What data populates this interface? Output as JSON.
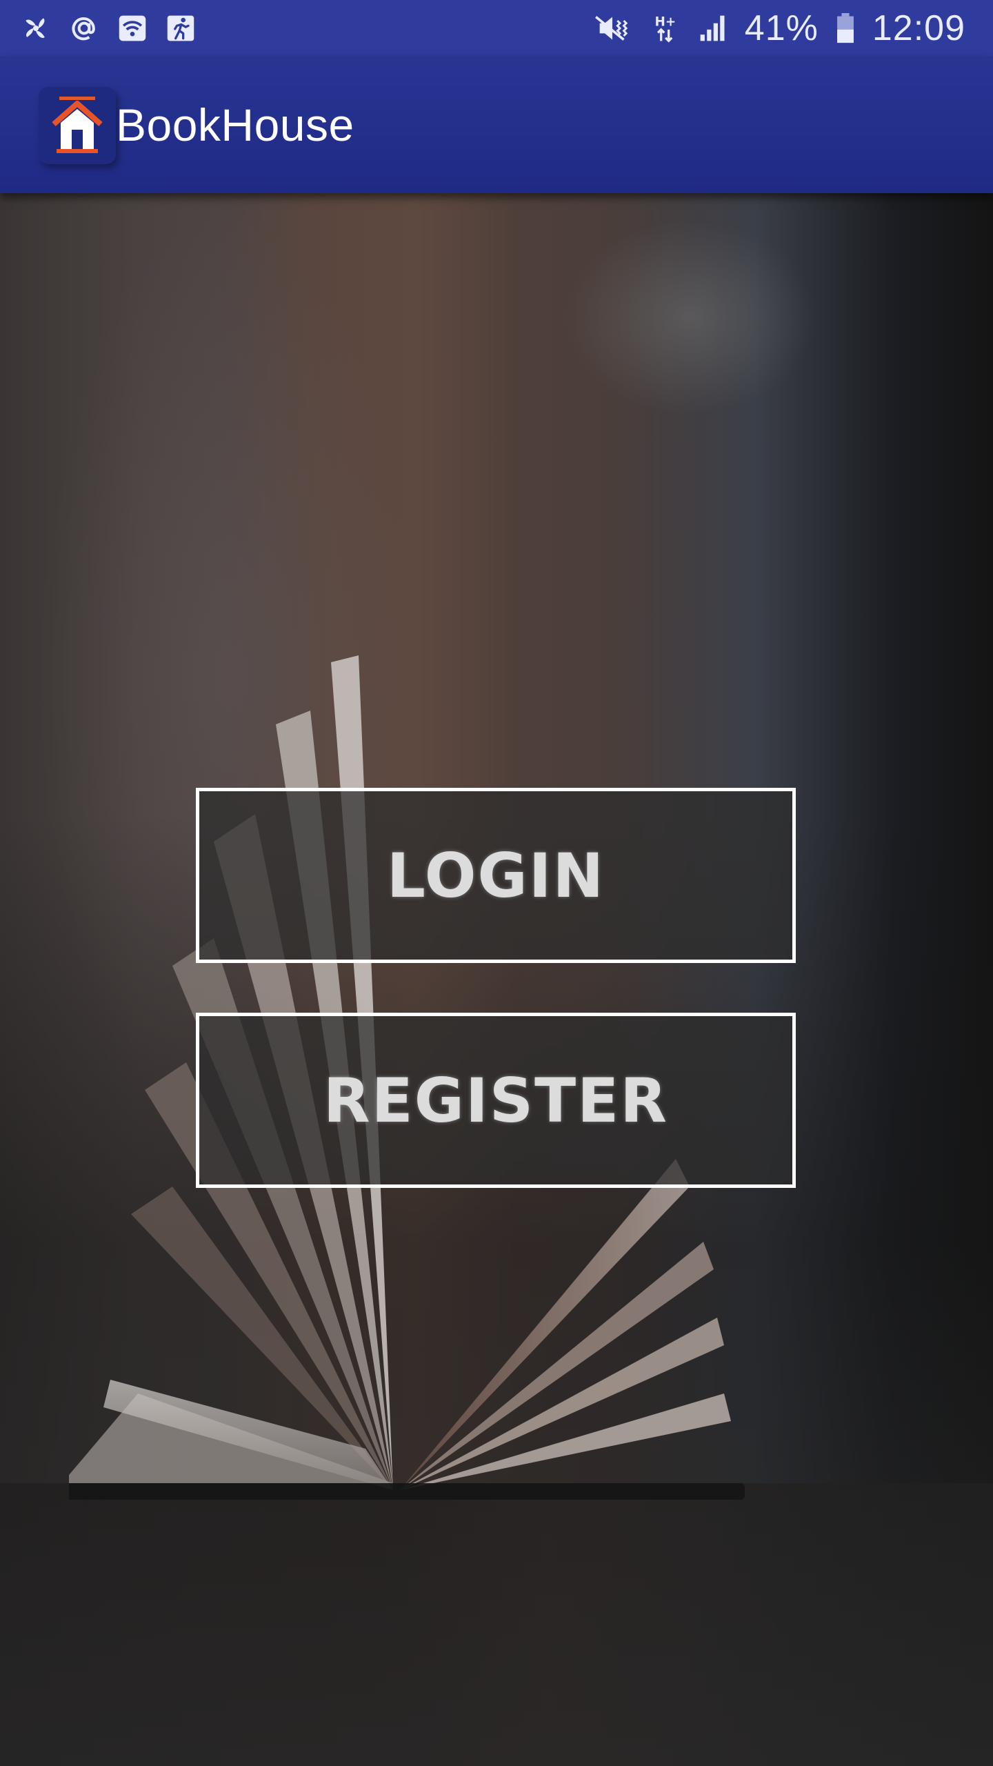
{
  "status_bar": {
    "left_icons": [
      "fan-icon",
      "at-sign-icon",
      "wifi-box-icon",
      "run-icon"
    ],
    "right_icons": [
      "mute-icon",
      "hplus-data-icon",
      "signal-icon",
      "battery-icon"
    ],
    "battery_percent": "41%",
    "time": "12:09"
  },
  "app_bar": {
    "logo_icon": "house-icon",
    "title": "BookHouse"
  },
  "buttons": {
    "login_label": "LOGIN",
    "register_label": "REGISTER"
  },
  "colors": {
    "status_bar": "#2f3c9d",
    "app_bar": "#283593",
    "button_border": "#ffffff"
  }
}
